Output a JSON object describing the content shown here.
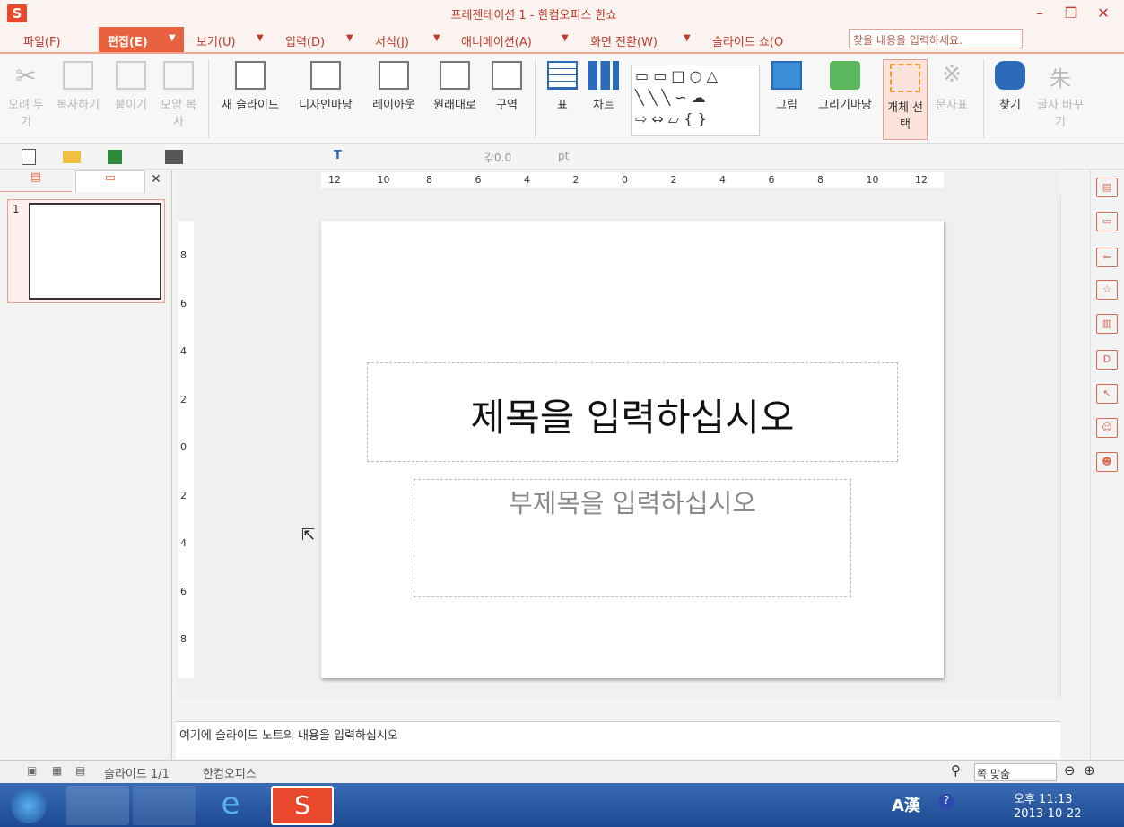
{
  "window": {
    "title": "프레젠테이션 1 - 한컴오피스 한쇼",
    "logo": "S"
  },
  "menu": [
    "파일(F)",
    "편집(E)",
    "보기(U)",
    "입력(D)",
    "서식(J)",
    "애니메이션(A)",
    "화면 전환(W)",
    "슬라이드 쇼(O"
  ],
  "search": {
    "placeholder": "찾을 내용을 입력하세요."
  },
  "ribbon": {
    "cut": "오려 두기",
    "copy": "복사하기",
    "paste": "붙이기",
    "format_copy": "모양 복사",
    "new_slide": "새 슬라이드",
    "design": "디자인마당",
    "layout": "레이아웃",
    "reset": "원래대로",
    "section": "구역",
    "table": "표",
    "chart": "차트",
    "picture": "그림",
    "drawing": "그리기마당",
    "select": "개체 선택",
    "symbol": "문자표",
    "find": "찾기",
    "replace": "글자 바꾸기"
  },
  "toolbar2": {
    "spacing": "0.0",
    "unit": "pt"
  },
  "panel": {
    "slide_num": "1"
  },
  "ruler": {
    "h": [
      "12",
      "10",
      "8",
      "6",
      "4",
      "2",
      "0",
      "2",
      "4",
      "6",
      "8",
      "10",
      "12"
    ],
    "v": [
      "8",
      "6",
      "4",
      "2",
      "0",
      "2",
      "4",
      "6",
      "8"
    ]
  },
  "slide": {
    "title": "제목을 입력하십시오",
    "subtitle": "부제목을 입력하십시오"
  },
  "notes": "여기에 슬라이드 노트의 내용을 입력하십시오",
  "status": {
    "slide": "슬라이드 1/1",
    "app": "한컴오피스",
    "zoom": "쪽 맞춤"
  },
  "taskbar": {
    "time": "오후 11:13",
    "date": "2013-10-22",
    "ime": "A漢"
  },
  "colors": {
    "accent": "#e8623f",
    "title_red": "#c0392b"
  }
}
